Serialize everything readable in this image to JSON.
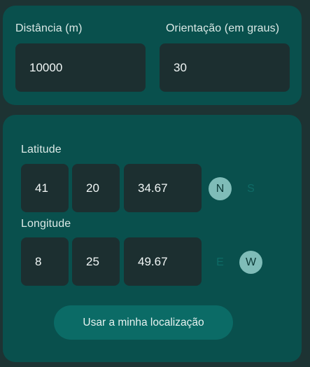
{
  "distance": {
    "label": "Distância (m)",
    "value": "10000"
  },
  "orientation": {
    "label": "Orientação (em graus)",
    "value": "30"
  },
  "latitude": {
    "label": "Latitude",
    "degrees": "41",
    "minutes": "20",
    "seconds": "34.67",
    "north_label": "N",
    "south_label": "S",
    "selected": "N"
  },
  "longitude": {
    "label": "Longitude",
    "degrees": "8",
    "minutes": "25",
    "seconds": "49.67",
    "east_label": "E",
    "west_label": "W",
    "selected": "W"
  },
  "use_location_button": "Usar a minha localização",
  "colors": {
    "background": "#1d3333",
    "card": "#09504d",
    "field": "#1c2f30",
    "toggle_active": "#7fbcb8",
    "button": "#0b6b66"
  }
}
